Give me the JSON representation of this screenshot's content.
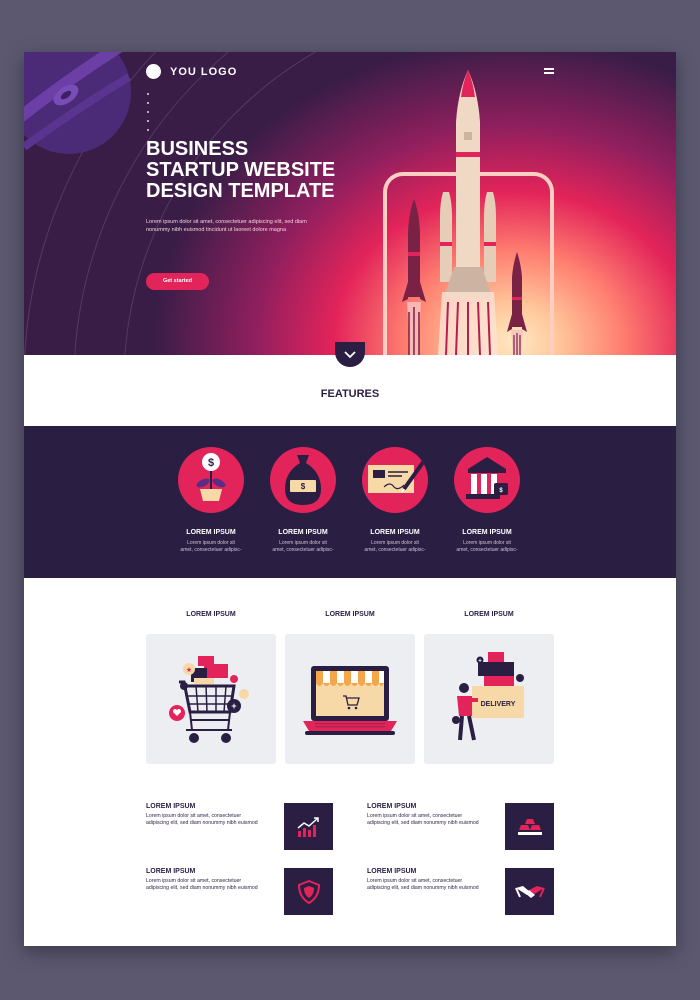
{
  "header": {
    "logo_text": "YOU LOGO",
    "menu_icon": "hamburger-menu-icon"
  },
  "hero": {
    "title_lines": [
      "BUSINESS",
      "STARTUP WEBSITE",
      "DESIGN TEMPLATE"
    ],
    "text_lines": [
      "Lorem ipsum dolor sit amet, consectetuer adipiscing elit, sed diam",
      "nonummy nibh euismod tincidunt ut laoreet dolore magna"
    ],
    "cta_label": "Get started",
    "scroll_icon": "chevron-down-icon"
  },
  "features": {
    "heading": "FEATURES",
    "items": [
      {
        "title": "LOREM IPSUM",
        "text_lines": [
          "Lorem ipsum dolor sit",
          "amet, consectetuer adipisc-"
        ],
        "icon": "money-plant-icon"
      },
      {
        "title": "LOREM IPSUM",
        "text_lines": [
          "Lorem ipsum dolor sit",
          "amet, consectetuer adipisc-"
        ],
        "icon": "money-bag-icon"
      },
      {
        "title": "LOREM IPSUM",
        "text_lines": [
          "Lorem ipsum dolor sit",
          "amet, consectetuer adipisc-"
        ],
        "icon": "check-signature-icon"
      },
      {
        "title": "LOREM IPSUM",
        "text_lines": [
          "Lorem ipsum dolor sit",
          "amet, consectetuer adipisc-"
        ],
        "icon": "bank-icon"
      }
    ]
  },
  "cards": [
    {
      "title": "LOREM IPSUM",
      "illustration": "shopping-cart-illustration"
    },
    {
      "title": "LOREM IPSUM",
      "illustration": "online-store-laptop-illustration"
    },
    {
      "title": "LOREM IPSUM",
      "illustration": "delivery-illustration",
      "box_label": "DELIVERY"
    }
  ],
  "info_items": [
    {
      "title": "LOREM IPSUM",
      "text_lines": [
        "Lorem ipsum dolor sit amet, consectetuer",
        "adipiscing elit, sed diam nonummy nibh euismod"
      ],
      "icon": "growth-chart-icon"
    },
    {
      "title": "LOREM IPSUM",
      "text_lines": [
        "Lorem ipsum dolor sit amet, consectetuer",
        "adipiscing elit, sed diam nonummy nibh euismod"
      ],
      "icon": "gold-bars-icon"
    },
    {
      "title": "LOREM IPSUM",
      "text_lines": [
        "Lorem ipsum dolor sit amet, consectetuer",
        "adipiscing elit, sed diam nonummy nibh euismod"
      ],
      "icon": "shield-icon"
    },
    {
      "title": "LOREM IPSUM",
      "text_lines": [
        "Lorem ipsum dolor sit amet, consectetuer",
        "adipiscing elit, sed diam nonummy nibh euismod"
      ],
      "icon": "handshake-icon"
    }
  ],
  "colors": {
    "primary_dark": "#2a1e43",
    "accent": "#e3245a",
    "background": "#5b5870",
    "card_background": "#eceef2",
    "cream": "#f6d9a6"
  }
}
